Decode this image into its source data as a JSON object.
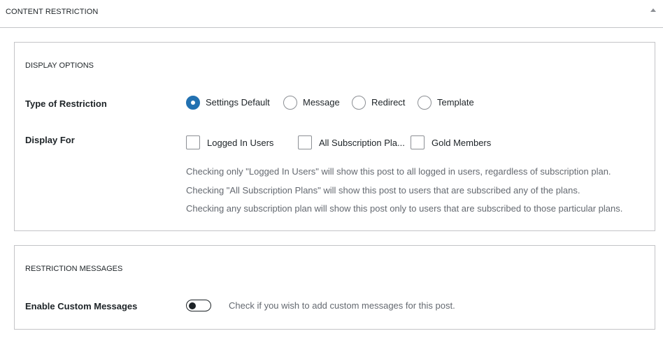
{
  "metabox": {
    "title": "CONTENT RESTRICTION",
    "toggle_icon": "triangle-up-icon"
  },
  "display_options": {
    "heading": "DISPLAY OPTIONS",
    "type_of_restriction": {
      "label": "Type of Restriction",
      "options": [
        {
          "label": "Settings Default",
          "checked": true
        },
        {
          "label": "Message",
          "checked": false
        },
        {
          "label": "Redirect",
          "checked": false
        },
        {
          "label": "Template",
          "checked": false
        }
      ]
    },
    "display_for": {
      "label": "Display For",
      "options": [
        {
          "label": "Logged In Users",
          "checked": false
        },
        {
          "label": "All Subscription Pla...",
          "checked": false
        },
        {
          "label": "Gold Members",
          "checked": false
        }
      ],
      "help": [
        "Checking only \"Logged In Users\" will show this post to all logged in users, regardless of subscription plan.",
        "Checking \"All Subscription Plans\" will show this post to users that are subscribed any of the plans.",
        "Checking any subscription plan will show this post only to users that are subscribed to those particular plans."
      ]
    }
  },
  "restriction_messages": {
    "heading": "RESTRICTION MESSAGES",
    "enable_custom": {
      "label": "Enable Custom Messages",
      "enabled": false,
      "description": "Check if you wish to add custom messages for this post."
    }
  },
  "colors": {
    "accent": "#2271b1",
    "border": "#c3c4c7",
    "muted_text": "#646970"
  }
}
